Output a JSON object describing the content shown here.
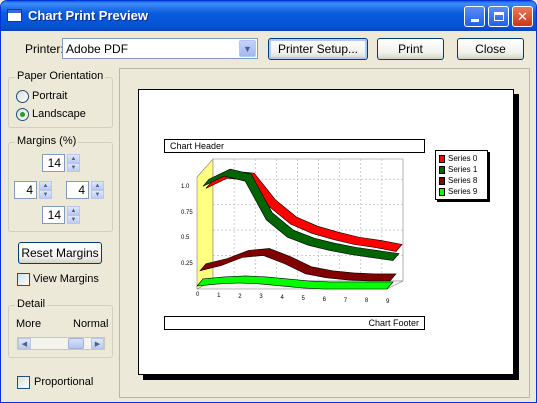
{
  "window": {
    "title": "Chart Print Preview"
  },
  "toolbar": {
    "printer_label": "Printer:",
    "printer_value": "Adobe PDF",
    "printer_setup_label": "Printer Setup...",
    "print_label": "Print",
    "close_label": "Close"
  },
  "orientation": {
    "title": "Paper Orientation",
    "portrait_label": "Portrait",
    "landscape_label": "Landscape",
    "selected": "Landscape"
  },
  "margins": {
    "title": "Margins (%)",
    "top": "14",
    "left": "4",
    "right": "4",
    "bottom": "14",
    "reset_label": "Reset Margins",
    "view_label": "View Margins"
  },
  "detail": {
    "title": "Detail",
    "more_label": "More",
    "normal_label": "Normal",
    "level": 0.85
  },
  "proportional_label": "Proportional",
  "chart_data": {
    "type": "line",
    "title": "Chart Header",
    "footer": "Chart Footer",
    "x": [
      "0",
      "1",
      "2",
      "3",
      "4",
      "5",
      "6",
      "7",
      "8",
      "9"
    ],
    "y_ticks": [
      "1.0",
      "0.75",
      "0.5",
      "0.25"
    ],
    "ylim": [
      0,
      1.1
    ],
    "legend_placement": "right",
    "grid": true,
    "series": [
      {
        "name": "Series 0",
        "color": "#ff0000",
        "values": [
          0.9,
          1.0,
          0.98,
          0.72,
          0.55,
          0.46,
          0.4,
          0.35,
          0.32,
          0.28
        ]
      },
      {
        "name": "Series 1",
        "color": "#006400",
        "values": [
          0.95,
          1.05,
          1.0,
          0.62,
          0.45,
          0.37,
          0.32,
          0.28,
          0.25,
          0.22
        ]
      },
      {
        "name": "Series 8",
        "color": "#800000",
        "values": [
          0.15,
          0.2,
          0.28,
          0.3,
          0.22,
          0.12,
          0.08,
          0.06,
          0.05,
          0.05
        ]
      },
      {
        "name": "Series 9",
        "color": "#00ff00",
        "values": [
          0.03,
          0.05,
          0.06,
          0.05,
          0.03,
          0.01,
          0.0,
          0.0,
          0.0,
          0.0
        ]
      }
    ]
  }
}
